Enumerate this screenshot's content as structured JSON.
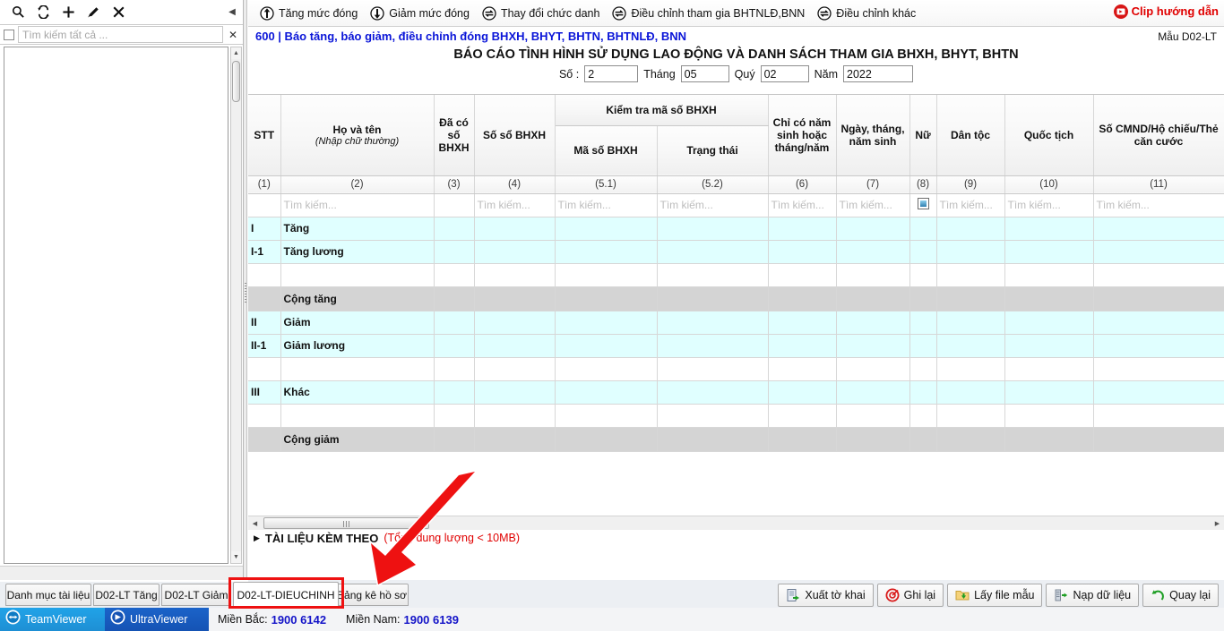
{
  "left_panel": {
    "toolbar_icons": [
      "search-icon",
      "refresh-icon",
      "add-icon",
      "edit-icon",
      "delete-icon"
    ],
    "collapse_glyph": "◀",
    "search_placeholder": "Tìm kiếm tất cả ...",
    "search_value": "",
    "clear_glyph": "✕"
  },
  "toolbar": {
    "items": [
      {
        "label": "Tăng mức đóng",
        "icon": "arrow-up-circle-icon"
      },
      {
        "label": "Giảm mức đóng",
        "icon": "arrow-down-circle-icon"
      },
      {
        "label": "Thay đổi chức danh",
        "icon": "swap-circle-icon"
      },
      {
        "label": "Điều chỉnh tham gia BHTNLĐ,BNN",
        "icon": "swap-circle-icon"
      },
      {
        "label": "Điều chỉnh khác",
        "icon": "swap-circle-icon"
      }
    ],
    "clip_guide": {
      "label": "Clip hướng dẫn",
      "icon": "video-play-icon"
    }
  },
  "document": {
    "header_code": "600 | Báo tăng, báo giảm, điều chỉnh đóng BHXH, BHYT, BHTN, BHTNLĐ, BNN",
    "form_code": "Mẫu D02-LT",
    "report_title": "BÁO CÁO TÌNH HÌNH SỬ DỤNG LAO ĐỘNG VÀ DANH SÁCH THAM GIA BHXH, BHYT, BHTN",
    "meta": {
      "so_label": "Số :",
      "so_value": "2",
      "thang_label": "Tháng",
      "thang_value": "05",
      "quy_label": "Quý",
      "quy_value": "02",
      "nam_label": "Năm",
      "nam_value": "2022"
    }
  },
  "grid": {
    "group_header": "Kiểm tra mã số BHXH",
    "columns": [
      {
        "title": "STT",
        "num": "(1)"
      },
      {
        "title": "Họ và tên",
        "sub": "(Nhập chữ thường)",
        "num": "(2)"
      },
      {
        "title": "Đã có số BHXH",
        "num": "(3)"
      },
      {
        "title": "Số sổ BHXH",
        "num": "(4)"
      },
      {
        "title": "Mã số BHXH",
        "num": "(5.1)"
      },
      {
        "title": "Trạng thái",
        "num": "(5.2)"
      },
      {
        "title": "Chỉ có năm sinh hoặc tháng/năm",
        "num": "(6)"
      },
      {
        "title": "Ngày, tháng, năm sinh",
        "num": "(7)"
      },
      {
        "title": "Nữ",
        "num": "(8)"
      },
      {
        "title": "Dân tộc",
        "num": "(9)"
      },
      {
        "title": "Quốc tịch",
        "num": "(10)"
      },
      {
        "title": "Số CMND/Hộ chiếu/Thẻ căn cước",
        "num": "(11)"
      }
    ],
    "filter_placeholder": "Tìm kiếm...",
    "filter_checkbox_icon": "checkbox-filter-icon",
    "rows": [
      {
        "type": "data",
        "stt": "I",
        "name": "Tăng"
      },
      {
        "type": "data",
        "stt": "I-1",
        "name": "Tăng lương"
      },
      {
        "type": "blank",
        "stt": "",
        "name": ""
      },
      {
        "type": "sum",
        "stt": "",
        "name": "Cộng tăng"
      },
      {
        "type": "data",
        "stt": "II",
        "name": "Giảm"
      },
      {
        "type": "data",
        "stt": "II-1",
        "name": "Giảm lương"
      },
      {
        "type": "blank",
        "stt": "",
        "name": ""
      },
      {
        "type": "data",
        "stt": "III",
        "name": "Khác"
      },
      {
        "type": "blank",
        "stt": "",
        "name": ""
      },
      {
        "type": "sum",
        "stt": "",
        "name": "Cộng giảm"
      }
    ]
  },
  "attachments": {
    "title": "TÀI LIỆU KÈM THEO",
    "note": "(Tổng dung lượng < 10MB)",
    "expander": "▶"
  },
  "tabs": [
    {
      "label": "Danh mục tài liệu",
      "active": false
    },
    {
      "label": "D02-LT Tăng",
      "active": false
    },
    {
      "label": "D02-LT Giảm",
      "active": false
    },
    {
      "label": "D02-LT-DIEUCHINH",
      "active": true
    },
    {
      "label": "Bảng kê hồ sơ",
      "active": false
    }
  ],
  "action_buttons": [
    {
      "label": "Xuất tờ khai",
      "icon": "export-form-icon"
    },
    {
      "label": "Ghi lại",
      "icon": "save-target-icon"
    },
    {
      "label": "Lấy file mẫu",
      "icon": "folder-download-icon"
    },
    {
      "label": "Nạp dữ liệu",
      "icon": "import-data-icon"
    },
    {
      "label": "Quay lại",
      "icon": "back-arrow-icon"
    }
  ],
  "statusbar": {
    "teamviewer": {
      "label": "TeamViewer",
      "icon": "teamviewer-icon"
    },
    "ultraviewer": {
      "label": "UltraViewer",
      "icon": "ultraviewer-icon"
    },
    "north_label": "Miền Bắc:",
    "north_number": "1900 6142",
    "south_label": "Miền Nam:",
    "south_number": "1900 6139"
  },
  "colors": {
    "title_blue": "#0a15d8",
    "alert_red": "#e00000",
    "data_row_cyan": "#e0ffff",
    "sum_row_gray": "#d4d4d4",
    "phone_blue": "#1414c8",
    "annotation_red": "#ee1111"
  }
}
